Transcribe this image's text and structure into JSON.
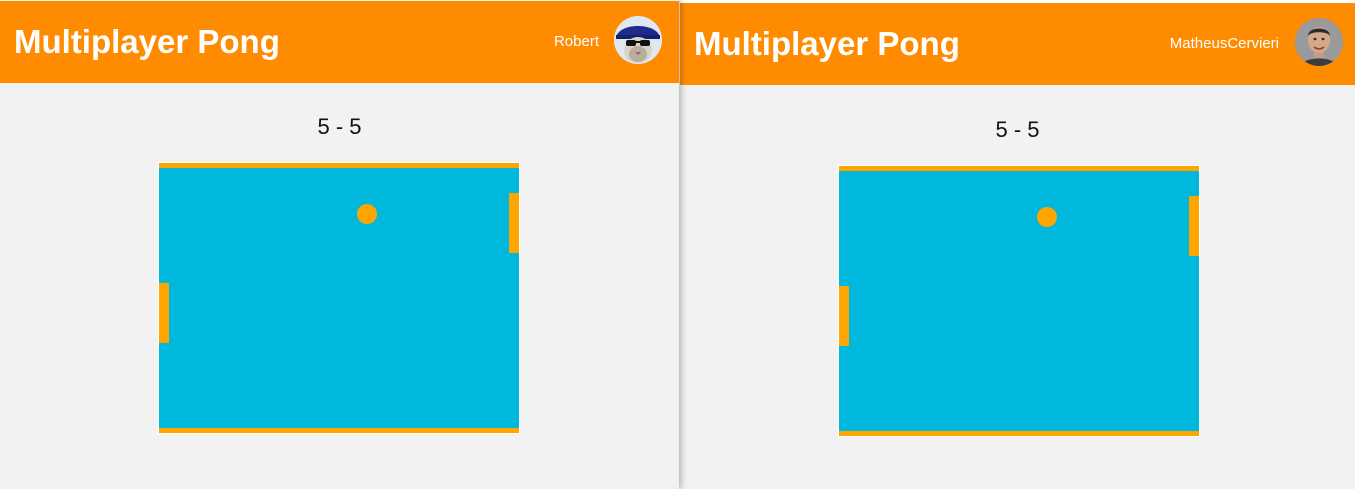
{
  "colors": {
    "header": "#ff8c00",
    "page_background": "#f2f2f2",
    "board": "#00b8db",
    "paddle_and_ball": "#ffa500",
    "text_on_header": "#ffffff"
  },
  "windows": [
    {
      "app_title": "Multiplayer Pong",
      "user_name": "Robert",
      "avatar_icon": "avatar-cat-with-sunglasses",
      "score": "5 - 5"
    },
    {
      "app_title": "Multiplayer Pong",
      "user_name": "MatheusCervieri",
      "avatar_icon": "avatar-man-photo",
      "score": "5 - 5"
    }
  ]
}
